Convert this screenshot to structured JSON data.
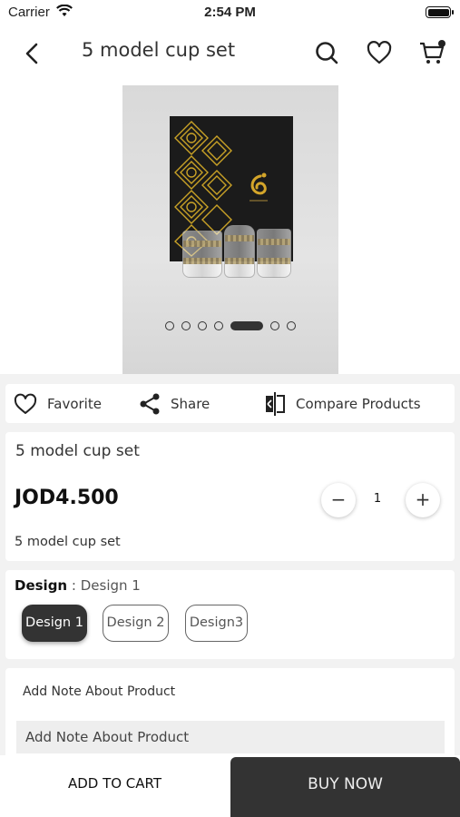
{
  "status_bar": {
    "carrier": "Carrier",
    "time": "2:54 PM"
  },
  "nav": {
    "title": "5 model cup set",
    "cart_badge": ""
  },
  "gallery": {
    "total_images": 7,
    "active_index": 4
  },
  "actions": {
    "favorite": "Favorite",
    "share": "Share",
    "compare": "Compare Products"
  },
  "product": {
    "name": "5 model cup set",
    "price": "JOD4.500",
    "description": "5 model cup set",
    "quantity": "1",
    "minus": "−",
    "plus": "+"
  },
  "design": {
    "label": "Design",
    "separator": " : ",
    "selected": "Design 1",
    "options": [
      "Design 1",
      "Design 2",
      "Design3"
    ]
  },
  "note": {
    "heading": "Add Note About Product",
    "placeholder": "Add Note About Product"
  },
  "footer": {
    "add_to_cart": "ADD TO CART",
    "buy_now": "BUY NOW"
  },
  "colors": {
    "primary_dark": "#333333",
    "background": "#f2f2f2",
    "gold": "#c9a227"
  }
}
